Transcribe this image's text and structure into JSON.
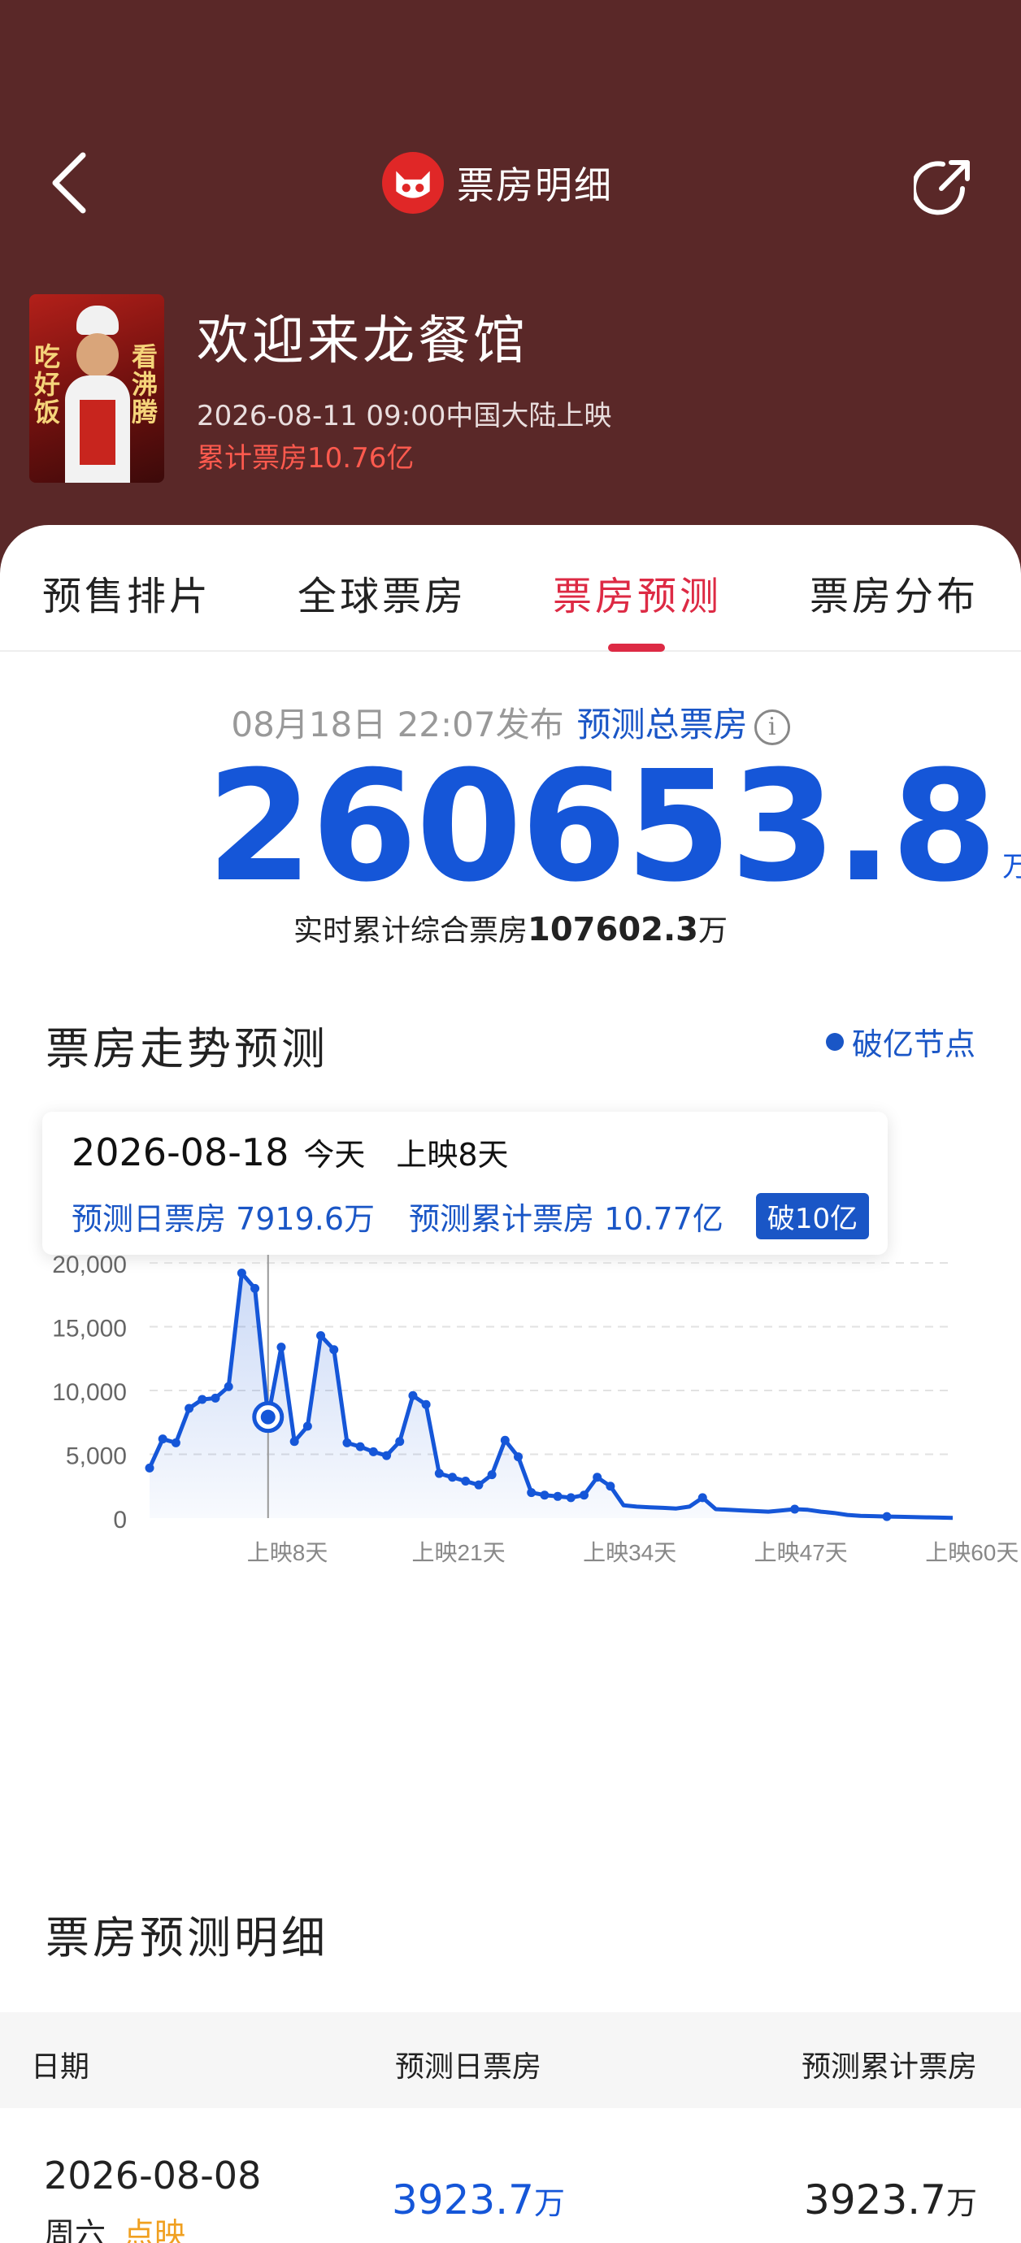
{
  "header": {
    "title": "票房明细",
    "movie": {
      "title": "欢迎来龙餐馆",
      "release": "2026-08-11 09:00中国大陆上映",
      "cumulative": "累计票房10.76亿",
      "poster_left_text": "吃好饭",
      "poster_right_text": "看沸腾"
    }
  },
  "tabs": [
    {
      "label": "预售排片",
      "active": false
    },
    {
      "label": "全球票房",
      "active": false
    },
    {
      "label": "票房预测",
      "active": true
    },
    {
      "label": "票房分布",
      "active": false
    }
  ],
  "forecast": {
    "published": "08月18日 22:07发布",
    "label": "预测总票房",
    "total": "260653.8",
    "unit": "万",
    "realtime_label": "实时累计综合票房",
    "realtime_value": "107602.3",
    "realtime_unit": "万"
  },
  "trend": {
    "title": "票房走势预测",
    "legend": "破亿节点",
    "tooltip": {
      "date": "2026-08-18",
      "today": "今天",
      "day_label": "上映8天",
      "daily": "预测日票房 7919.6万",
      "cumulative": "预测累计票房 10.77亿",
      "badge": "破10亿"
    }
  },
  "chart_data": {
    "type": "area",
    "ylim": [
      0,
      20000
    ],
    "yticks": [
      "20,000",
      "15,000",
      "10,000",
      "5,000",
      "0"
    ],
    "xticks": [
      "上映8天",
      "上映21天",
      "上映34天",
      "上映47天",
      "上映60天"
    ],
    "series": [
      {
        "x": [
          0,
          1,
          2,
          3,
          4,
          5,
          6,
          7,
          8,
          9,
          10,
          11,
          12,
          13,
          14,
          15,
          16,
          17,
          18,
          19,
          20,
          21,
          22,
          23,
          24,
          25,
          26,
          27,
          28,
          29,
          30,
          31,
          32,
          33,
          34,
          35,
          36,
          37,
          38,
          39,
          40,
          41,
          42,
          43,
          44,
          45,
          46,
          47,
          48,
          49,
          50,
          51,
          52,
          53,
          54,
          55,
          56,
          57,
          58,
          59,
          60,
          61
        ],
        "y": [
          3923.7,
          6200,
          5900,
          8600,
          9300,
          9400,
          10300,
          19200,
          18000,
          7919.6,
          13400,
          6000,
          7200,
          14300,
          13200,
          5900,
          5600,
          5200,
          4900,
          6000,
          9600,
          8900,
          3500,
          3200,
          2900,
          2600,
          3400,
          6100,
          4800,
          2000,
          1800,
          1700,
          1600,
          1800,
          3200,
          2500,
          1000,
          900,
          850,
          800,
          750,
          900,
          1600,
          700,
          650,
          600,
          550,
          500,
          600,
          700,
          650,
          500,
          400,
          250,
          180,
          150,
          120,
          100,
          80,
          60,
          40,
          20
        ]
      }
    ],
    "milestone_index": 9,
    "grid": true
  },
  "detail": {
    "title": "票房预测明细",
    "columns": [
      "日期",
      "预测日票房",
      "预测累计票房"
    ],
    "rows": [
      {
        "date": "2026-08-08",
        "weekday": "周六",
        "tag": "点映",
        "daily": "3923.7",
        "daily_unit": "万",
        "cum": "3923.7",
        "cum_unit": "万"
      }
    ]
  },
  "colors": {
    "header_bg": "#5a2828",
    "accent_red": "#dd2a44",
    "accent_blue": "#1556d8",
    "tag_orange": "#f0a020"
  }
}
